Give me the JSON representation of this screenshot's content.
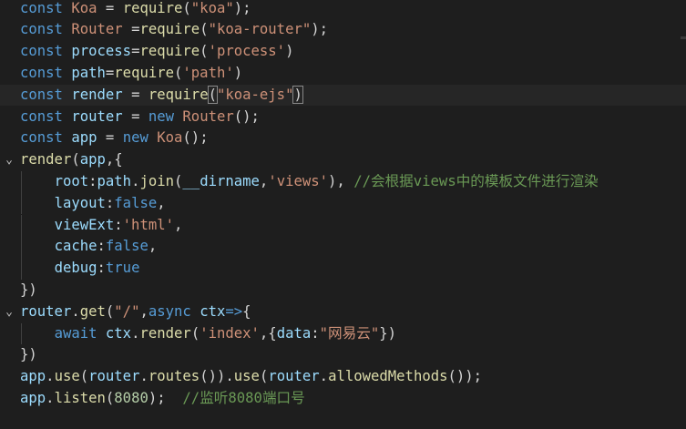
{
  "lines": [
    {
      "fold": "",
      "guide": false,
      "tokens": [
        [
          "const",
          "kw"
        ],
        [
          " ",
          "plain"
        ],
        [
          "Koa",
          "str"
        ],
        [
          " = ",
          "plain"
        ],
        [
          "require",
          "fn"
        ],
        [
          "(",
          "plain"
        ],
        [
          "\"koa\"",
          "str"
        ],
        [
          ");",
          "plain"
        ]
      ]
    },
    {
      "fold": "",
      "guide": false,
      "tokens": [
        [
          "const",
          "kw"
        ],
        [
          " ",
          "plain"
        ],
        [
          "Router",
          "str"
        ],
        [
          " =",
          "plain"
        ],
        [
          "require",
          "fn"
        ],
        [
          "(",
          "plain"
        ],
        [
          "\"koa-router\"",
          "str"
        ],
        [
          ");",
          "plain"
        ]
      ]
    },
    {
      "fold": "",
      "guide": false,
      "tokens": [
        [
          "const",
          "kw"
        ],
        [
          " ",
          "plain"
        ],
        [
          "process",
          "var"
        ],
        [
          "=",
          "plain"
        ],
        [
          "require",
          "fn"
        ],
        [
          "(",
          "plain"
        ],
        [
          "'process'",
          "str"
        ],
        [
          ")",
          "plain"
        ]
      ]
    },
    {
      "fold": "",
      "guide": false,
      "tokens": [
        [
          "const",
          "kw"
        ],
        [
          " ",
          "plain"
        ],
        [
          "path",
          "var"
        ],
        [
          "=",
          "plain"
        ],
        [
          "require",
          "fn"
        ],
        [
          "(",
          "plain"
        ],
        [
          "'path'",
          "str"
        ],
        [
          ")",
          "plain"
        ]
      ]
    },
    {
      "fold": "",
      "guide": false,
      "current": true,
      "tokens": [
        [
          "const",
          "kw"
        ],
        [
          " ",
          "plain"
        ],
        [
          "render",
          "var"
        ],
        [
          " = ",
          "plain"
        ],
        [
          "require",
          "fn"
        ],
        [
          "(",
          "brk-match"
        ],
        [
          "\"koa-ejs\"",
          "str"
        ],
        [
          ")",
          "brk-match"
        ]
      ]
    },
    {
      "fold": "",
      "guide": false,
      "tokens": [
        [
          "const",
          "kw"
        ],
        [
          " ",
          "plain"
        ],
        [
          "router",
          "var"
        ],
        [
          " = ",
          "plain"
        ],
        [
          "new",
          "kw"
        ],
        [
          " ",
          "plain"
        ],
        [
          "Router",
          "str"
        ],
        [
          "();",
          "plain"
        ]
      ]
    },
    {
      "fold": "",
      "guide": false,
      "tokens": [
        [
          "const",
          "kw"
        ],
        [
          " ",
          "plain"
        ],
        [
          "app",
          "var"
        ],
        [
          " = ",
          "plain"
        ],
        [
          "new",
          "kw"
        ],
        [
          " ",
          "plain"
        ],
        [
          "Koa",
          "str"
        ],
        [
          "();",
          "plain"
        ]
      ]
    },
    {
      "fold": "⌄",
      "guide": false,
      "tokens": [
        [
          "render",
          "fn"
        ],
        [
          "(",
          "plain"
        ],
        [
          "app",
          "var"
        ],
        [
          ",{",
          "plain"
        ]
      ]
    },
    {
      "fold": "",
      "guide": true,
      "tokens": [
        [
          "    ",
          "plain"
        ],
        [
          "root",
          "var"
        ],
        [
          ":",
          "plain"
        ],
        [
          "path",
          "var"
        ],
        [
          ".",
          "plain"
        ],
        [
          "join",
          "fn"
        ],
        [
          "(",
          "plain"
        ],
        [
          "__dirname",
          "var"
        ],
        [
          ",",
          "plain"
        ],
        [
          "'views'",
          "str"
        ],
        [
          "), ",
          "plain"
        ],
        [
          "//会根据views中的模板文件进行渲染",
          "com"
        ]
      ]
    },
    {
      "fold": "",
      "guide": true,
      "tokens": [
        [
          "    ",
          "plain"
        ],
        [
          "layout",
          "var"
        ],
        [
          ":",
          "plain"
        ],
        [
          "false",
          "kw"
        ],
        [
          ",",
          "plain"
        ]
      ]
    },
    {
      "fold": "",
      "guide": true,
      "tokens": [
        [
          "    ",
          "plain"
        ],
        [
          "viewExt",
          "var"
        ],
        [
          ":",
          "plain"
        ],
        [
          "'html'",
          "str"
        ],
        [
          ",",
          "plain"
        ]
      ]
    },
    {
      "fold": "",
      "guide": true,
      "tokens": [
        [
          "    ",
          "plain"
        ],
        [
          "cache",
          "var"
        ],
        [
          ":",
          "plain"
        ],
        [
          "false",
          "kw"
        ],
        [
          ",",
          "plain"
        ]
      ]
    },
    {
      "fold": "",
      "guide": true,
      "tokens": [
        [
          "    ",
          "plain"
        ],
        [
          "debug",
          "var"
        ],
        [
          ":",
          "plain"
        ],
        [
          "true",
          "kw"
        ]
      ]
    },
    {
      "fold": "",
      "guide": false,
      "tokens": [
        [
          "})",
          "plain"
        ]
      ]
    },
    {
      "fold": "⌄",
      "guide": false,
      "tokens": [
        [
          "router",
          "var"
        ],
        [
          ".",
          "plain"
        ],
        [
          "get",
          "fn"
        ],
        [
          "(",
          "plain"
        ],
        [
          "\"/\"",
          "str"
        ],
        [
          ",",
          "plain"
        ],
        [
          "async",
          "kw"
        ],
        [
          " ",
          "plain"
        ],
        [
          "ctx",
          "var"
        ],
        [
          "=>",
          "kw"
        ],
        [
          "{",
          "plain"
        ]
      ]
    },
    {
      "fold": "",
      "guide": true,
      "tokens": [
        [
          "    ",
          "plain"
        ],
        [
          "await",
          "kw"
        ],
        [
          " ",
          "plain"
        ],
        [
          "ctx",
          "var"
        ],
        [
          ".",
          "plain"
        ],
        [
          "render",
          "fn"
        ],
        [
          "(",
          "plain"
        ],
        [
          "'index'",
          "str"
        ],
        [
          ",{",
          "plain"
        ],
        [
          "data",
          "var"
        ],
        [
          ":",
          "plain"
        ],
        [
          "\"网易云\"",
          "str"
        ],
        [
          "})",
          "plain"
        ]
      ]
    },
    {
      "fold": "",
      "guide": false,
      "tokens": [
        [
          "})",
          "plain"
        ]
      ]
    },
    {
      "fold": "",
      "guide": false,
      "tokens": [
        [
          "app",
          "var"
        ],
        [
          ".",
          "plain"
        ],
        [
          "use",
          "fn"
        ],
        [
          "(",
          "plain"
        ],
        [
          "router",
          "var"
        ],
        [
          ".",
          "plain"
        ],
        [
          "routes",
          "fn"
        ],
        [
          "()).",
          "plain"
        ],
        [
          "use",
          "fn"
        ],
        [
          "(",
          "plain"
        ],
        [
          "router",
          "var"
        ],
        [
          ".",
          "plain"
        ],
        [
          "allowedMethods",
          "fn"
        ],
        [
          "());",
          "plain"
        ]
      ]
    },
    {
      "fold": "",
      "guide": false,
      "tokens": [
        [
          "app",
          "var"
        ],
        [
          ".",
          "plain"
        ],
        [
          "listen",
          "fn"
        ],
        [
          "(",
          "plain"
        ],
        [
          "8080",
          "num"
        ],
        [
          ");  ",
          "plain"
        ],
        [
          "//监听8080端口号",
          "com"
        ]
      ]
    }
  ]
}
